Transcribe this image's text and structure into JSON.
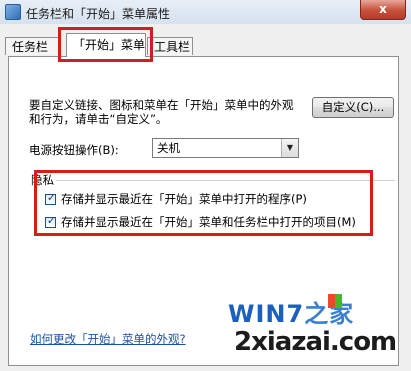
{
  "window": {
    "title": "任务栏和「开始」菜单属性",
    "close_label": "x"
  },
  "tabs": [
    {
      "label": "任务栏"
    },
    {
      "label": "「开始」菜单"
    },
    {
      "label": "工具栏"
    }
  ],
  "start_menu": {
    "description": "要自定义链接、图标和菜单在「开始」菜单中的外观和行为，请单击“自定义”。",
    "customize_button": "自定义(C)...",
    "power_button_label": "电源按钮操作(B):",
    "power_button_value": "关机",
    "privacy_group_title": "隐私",
    "privacy_options": [
      {
        "label": "存储并显示最近在「开始」菜单中打开的程序(P)",
        "checked": true
      },
      {
        "label": "存储并显示最近在「开始」菜单和任务栏中打开的项目(M)",
        "checked": true
      }
    ],
    "appearance_link": "如何更改「开始」菜单的外观?"
  },
  "watermark": {
    "logo_text": "WIN7",
    "logo_home": "之家",
    "site": "2xiazai.com"
  },
  "colors": {
    "highlight_box": "#d11e1e",
    "link": "#1a4fa8"
  }
}
